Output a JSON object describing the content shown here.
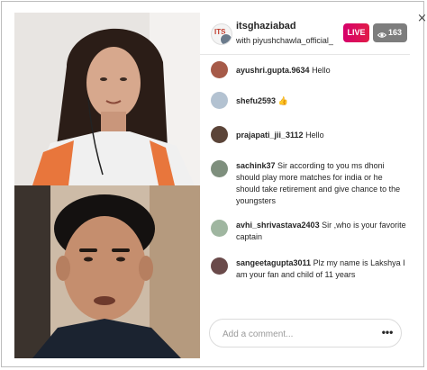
{
  "header": {
    "host_username": "itsghaziabad",
    "with_text": "with piyushchawla_official_",
    "live_label": "LIVE",
    "viewer_count": "163"
  },
  "comments": [
    {
      "user": "ayushri.gupta.9634",
      "text": "Hello"
    },
    {
      "user": "shefu2593",
      "text": "👍"
    },
    {
      "user": "prajapati_jii_3112",
      "text": "Hello"
    },
    {
      "user": "sachink37",
      "text": "Sir according to you ms dhoni should play more matches for india or he should take retirement and give chance to the youngsters"
    },
    {
      "user": "avhi_shrivastava2403",
      "text": "Sir ,who is your favorite captain"
    },
    {
      "user": "sangeetagupta3011",
      "text": "Plz my name is Lakshya I am your fan and child of 11 years"
    }
  ],
  "composer": {
    "placeholder": "Add a comment...",
    "more_label": "•••"
  },
  "close_label": "×",
  "host_avatar_tag": "ITS"
}
